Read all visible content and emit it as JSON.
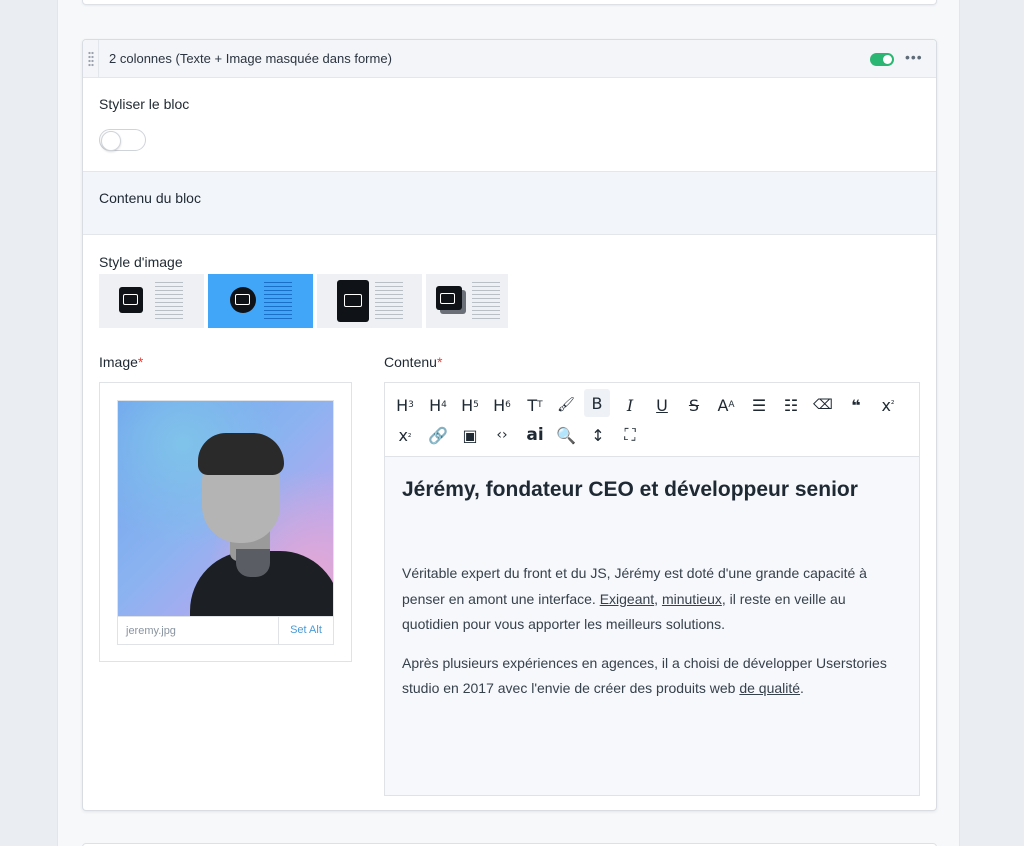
{
  "block": {
    "title": "2 colonnes (Texte + Image masquée dans forme)",
    "enabled": true,
    "more_label": "•••"
  },
  "style_block": {
    "label": "Styliser le bloc",
    "enabled": false
  },
  "content_section": {
    "label": "Contenu du bloc"
  },
  "image_style": {
    "label": "Style d'image",
    "options": [
      "square-image-style",
      "circle-image-style",
      "tall-image-style",
      "stacked-image-style"
    ],
    "selected_index": 1
  },
  "image_field": {
    "label": "Image",
    "required_mark": "*",
    "filename": "jeremy.jpg",
    "set_alt_label": "Set Alt"
  },
  "content_field": {
    "label": "Contenu",
    "required_mark": "*"
  },
  "toolbar": {
    "row1": [
      "H3",
      "H4",
      "H5",
      "H6",
      "Tт",
      "🖌",
      "B",
      "I",
      "U",
      "S",
      "A",
      "•≡",
      "1≡",
      "⌫",
      "❝",
      "x²"
    ],
    "row2": [
      "x₂",
      "🔗",
      "▣",
      "<>",
      "ai",
      "🔍",
      "↕",
      "⛶"
    ]
  },
  "editor": {
    "heading": "Jérémy, fondateur CEO et développeur senior",
    "p1_a": "Véritable expert du front et du JS, Jérémy est doté d'une grande capacité à penser en amont une interface. ",
    "p1_link1": "Exigeant",
    "p1_sep": ", ",
    "p1_link2": "minutieux",
    "p1_b": ", il reste en veille au quotidien pour vous apporter les meilleurs solutions.",
    "p2_a": "Après plusieurs expériences en agences, il a choisi de développer Userstories studio en 2017 avec l'envie de créer des produits web ",
    "p2_link": "de qualité",
    "p2_b": "."
  },
  "colors": {
    "accent": "#41a6f7",
    "toggle_on": "#2bb673",
    "required": "#e0433c",
    "link": "#4a9bd6"
  }
}
